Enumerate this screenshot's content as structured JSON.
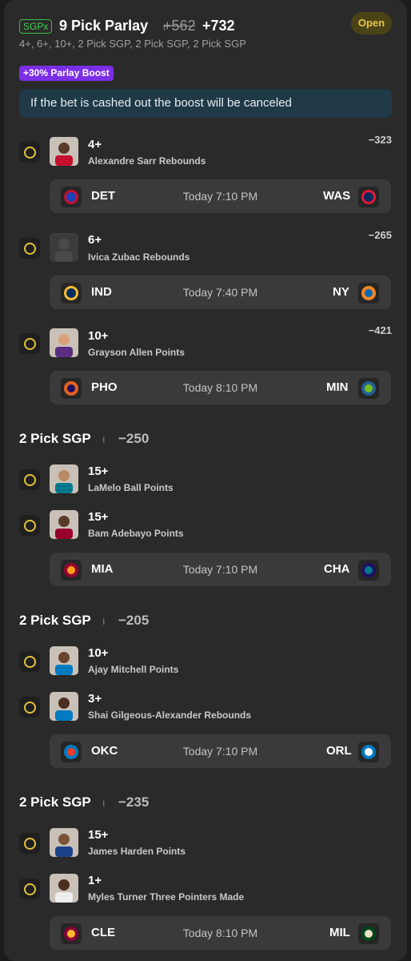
{
  "header": {
    "badge": "SGPx",
    "title": "9 Pick Parlay",
    "separator": "I",
    "odds_old": "+562",
    "odds_new": "+732",
    "subtitle": "4+, 6+, 10+, 2 Pick SGP, 2 Pick SGP, 2 Pick SGP",
    "status": "Open",
    "boost": "+30% Parlay Boost",
    "notice": "If the bet is cashed out the boost will be canceled"
  },
  "picks": [
    {
      "line": "4+",
      "market": "Alexandre Sarr Rebounds",
      "price": "−323"
    },
    {
      "line": "6+",
      "market": "Ivica Zubac Rebounds",
      "price": "−265"
    },
    {
      "line": "10+",
      "market": "Grayson Allen Points",
      "price": "−421"
    }
  ],
  "games": [
    {
      "home": "DET",
      "time": "Today 7:10 PM",
      "away": "WAS",
      "home_icon": "pistons-logo",
      "away_icon": "wizards-logo"
    },
    {
      "home": "IND",
      "time": "Today 7:40 PM",
      "away": "NY",
      "home_icon": "pacers-logo",
      "away_icon": "knicks-logo"
    },
    {
      "home": "PHO",
      "time": "Today 8:10 PM",
      "away": "MIN",
      "home_icon": "suns-logo",
      "away_icon": "timberwolves-logo"
    },
    {
      "home": "MIA",
      "time": "Today 7:10 PM",
      "away": "CHA",
      "home_icon": "heat-logo",
      "away_icon": "hornets-logo"
    },
    {
      "home": "OKC",
      "time": "Today 7:10 PM",
      "away": "ORL",
      "home_icon": "thunder-logo",
      "away_icon": "magic-logo"
    },
    {
      "home": "CLE",
      "time": "Today 8:10 PM",
      "away": "MIL",
      "home_icon": "cavaliers-logo",
      "away_icon": "bucks-logo"
    }
  ],
  "sgps": [
    {
      "title": "2 Pick SGP",
      "separator": "I",
      "odds": "−250",
      "legs": [
        {
          "line": "15+",
          "market": "LaMelo Ball Points"
        },
        {
          "line": "15+",
          "market": "Bam Adebayo Points"
        }
      ]
    },
    {
      "title": "2 Pick SGP",
      "separator": "I",
      "odds": "−205",
      "legs": [
        {
          "line": "10+",
          "market": "Ajay Mitchell Points"
        },
        {
          "line": "3+",
          "market": "Shai Gilgeous-Alexander Rebounds"
        }
      ]
    },
    {
      "title": "2 Pick SGP",
      "separator": "I",
      "odds": "−235",
      "legs": [
        {
          "line": "15+",
          "market": "James Harden Points"
        },
        {
          "line": "1+",
          "market": "Myles Turner Three Pointers Made"
        }
      ]
    }
  ],
  "colors": {
    "accent_green": "#45d157",
    "status_yellow": "#e8c547",
    "boost_purple": "#7c2ee6",
    "pending_circle": "#e3c33a"
  }
}
